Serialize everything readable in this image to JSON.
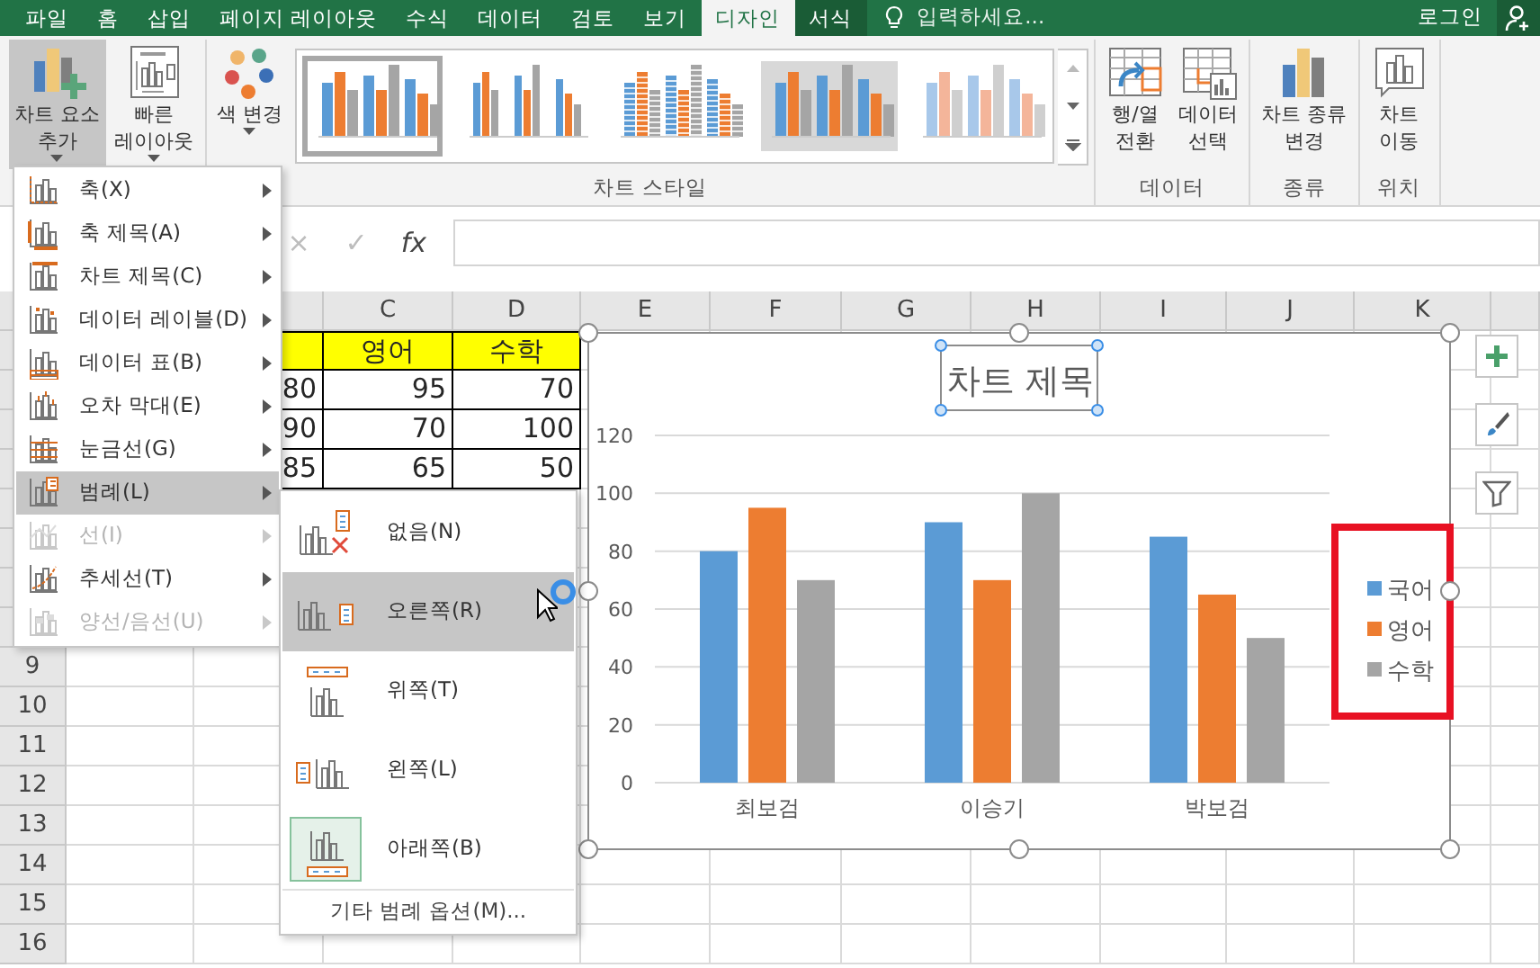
{
  "tabs": [
    {
      "label": "파일",
      "selected": false,
      "kind": "normal"
    },
    {
      "label": "홈",
      "selected": false,
      "kind": "normal"
    },
    {
      "label": "삽입",
      "selected": false,
      "kind": "normal"
    },
    {
      "label": "페이지 레이아웃",
      "selected": false,
      "kind": "normal"
    },
    {
      "label": "수식",
      "selected": false,
      "kind": "normal"
    },
    {
      "label": "데이터",
      "selected": false,
      "kind": "normal"
    },
    {
      "label": "검토",
      "selected": false,
      "kind": "normal"
    },
    {
      "label": "보기",
      "selected": false,
      "kind": "normal"
    },
    {
      "label": "디자인",
      "selected": true,
      "kind": "context"
    },
    {
      "label": "서식",
      "selected": false,
      "kind": "context"
    }
  ],
  "tell_me": {
    "placeholder": "입력하세요..."
  },
  "account": {
    "label": "로그인"
  },
  "ribbon": {
    "groups": [
      {
        "buttons": [
          {
            "kind": "add-element",
            "label": "차트 요소\n추가",
            "pressed": true,
            "dropdown": true
          },
          {
            "kind": "quick-layout",
            "label": "빠른\n레이아웃",
            "pressed": false,
            "dropdown": true
          }
        ]
      },
      {
        "label": "차트 스타일",
        "buttons": [
          {
            "kind": "color",
            "label": "색 변경",
            "pressed": false,
            "dropdown": true
          }
        ],
        "gallery": [
          {
            "kind": "plain",
            "selected": true
          },
          {
            "kind": "labels",
            "selected": false
          },
          {
            "kind": "hatched",
            "selected": false
          },
          {
            "kind": "shaded",
            "selected": false
          },
          {
            "kind": "pale",
            "selected": false
          }
        ]
      },
      {
        "label": "데이터",
        "buttons": [
          {
            "kind": "switch",
            "label": "행/열\n전환",
            "pressed": false,
            "dropdown": false
          },
          {
            "kind": "select-data",
            "label": "데이터\n선택",
            "pressed": false,
            "dropdown": false
          }
        ]
      },
      {
        "label": "종류",
        "buttons": [
          {
            "kind": "change-type",
            "label": "차트 종류\n변경",
            "pressed": false,
            "dropdown": false
          }
        ]
      },
      {
        "label": "위치",
        "buttons": [
          {
            "kind": "move",
            "label": "차트\n이동",
            "pressed": false,
            "dropdown": false
          }
        ]
      }
    ]
  },
  "formula_bar": {
    "buttons": [
      {
        "label": "×",
        "disabled": true
      },
      {
        "label": "✓",
        "disabled": true
      },
      {
        "label": "fx",
        "disabled": false
      }
    ]
  },
  "sheet": {
    "column_headers": [
      "C",
      "D",
      "E",
      "F",
      "G",
      "H",
      "I",
      "J",
      "K"
    ],
    "row_numbers": [
      "9",
      "10",
      "11",
      "12",
      "13",
      "14",
      "15",
      "16"
    ],
    "table": {
      "header": [
        "영어",
        "수학"
      ],
      "rows": [
        [
          "80",
          "95",
          "70"
        ],
        [
          "90",
          "70",
          "100"
        ],
        [
          "85",
          "65",
          "50"
        ]
      ]
    }
  },
  "chart": {
    "selected": true,
    "title": "차트 제목",
    "title_selected": true,
    "legend_highlighted": true,
    "chart_data": {
      "type": "bar",
      "categories": [
        "최보검",
        "이승기",
        "박보검"
      ],
      "series": [
        {
          "name": "국어",
          "color": "#5b9bd5",
          "values": [
            80,
            90,
            85
          ]
        },
        {
          "name": "영어",
          "color": "#ed7d31",
          "values": [
            95,
            70,
            65
          ]
        },
        {
          "name": "수학",
          "color": "#a5a5a5",
          "values": [
            70,
            100,
            50
          ]
        }
      ],
      "ylim": [
        0,
        120
      ],
      "yticks": [
        {
          "value": 0,
          "label": "0"
        },
        {
          "value": 20,
          "label": "20"
        },
        {
          "value": 40,
          "label": "40"
        },
        {
          "value": 60,
          "label": "60"
        },
        {
          "value": 80,
          "label": "80"
        },
        {
          "value": 100,
          "label": "100"
        },
        {
          "value": 120,
          "label": "120"
        }
      ],
      "grid": true,
      "legend": true
    },
    "tools": [
      {
        "kind": "add"
      },
      {
        "kind": "style"
      },
      {
        "kind": "filter"
      }
    ]
  },
  "menu": {
    "items": [
      {
        "label": "축(X)",
        "kind": "axis",
        "highlighted": false,
        "disabled": false
      },
      {
        "label": "축 제목(A)",
        "kind": "axis-title",
        "highlighted": false,
        "disabled": false
      },
      {
        "label": "차트 제목(C)",
        "kind": "chart-title",
        "highlighted": false,
        "disabled": false
      },
      {
        "label": "데이터 레이블(D)",
        "kind": "data-labels",
        "highlighted": false,
        "disabled": false
      },
      {
        "label": "데이터 표(B)",
        "kind": "data-table",
        "highlighted": false,
        "disabled": false
      },
      {
        "label": "오차 막대(E)",
        "kind": "error-bars",
        "highlighted": false,
        "disabled": false
      },
      {
        "label": "눈금선(G)",
        "kind": "gridlines",
        "highlighted": false,
        "disabled": false
      },
      {
        "label": "범례(L)",
        "kind": "legend",
        "highlighted": true,
        "disabled": false
      },
      {
        "label": "선(I)",
        "kind": "lines",
        "highlighted": false,
        "disabled": true
      },
      {
        "label": "추세선(T)",
        "kind": "trendline",
        "highlighted": false,
        "disabled": false
      },
      {
        "label": "양선/음선(U)",
        "kind": "updown",
        "highlighted": false,
        "disabled": true
      }
    ]
  },
  "submenu": {
    "items": [
      {
        "label": "없음(N)",
        "kind": "none",
        "highlighted": false,
        "selected": false
      },
      {
        "label": "오른쪽(R)",
        "kind": "right",
        "highlighted": true,
        "selected": false
      },
      {
        "label": "위쪽(T)",
        "kind": "top",
        "highlighted": false,
        "selected": false
      },
      {
        "label": "왼쪽(L)",
        "kind": "left",
        "highlighted": false,
        "selected": false
      },
      {
        "label": "아래쪽(B)",
        "kind": "bottom",
        "highlighted": false,
        "selected": true
      }
    ],
    "footer": "기타 범례 옵션(M)..."
  }
}
